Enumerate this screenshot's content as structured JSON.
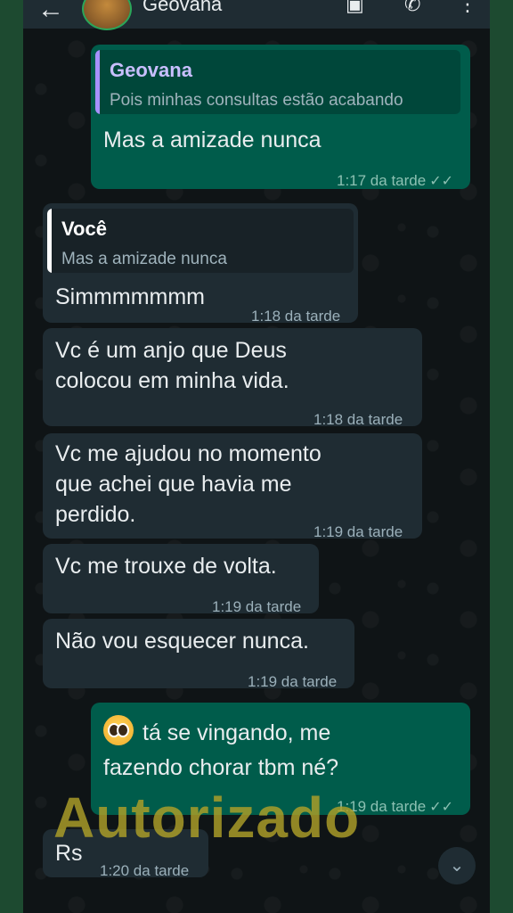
{
  "header": {
    "back_icon": "arrow-left-icon",
    "contact_name": "Geovana",
    "icons": [
      "video-icon",
      "call-icon",
      "more-vert-icon"
    ]
  },
  "messages": [
    {
      "dir": "out",
      "quote_name": "Geovana",
      "quote_text": "Pois minhas consultas estão acabando",
      "text": "Mas a amizade nunca",
      "time": "1:17 da tarde"
    },
    {
      "dir": "in",
      "quote_name": "Você",
      "quote_text": "Mas a amizade nunca",
      "text": "Simmmmmmm",
      "time": "1:18 da tarde"
    },
    {
      "dir": "in",
      "text_lines": [
        "Vc é  um anjo  que Deus",
        "colocou em minha  vida."
      ],
      "time": "1:18 da tarde"
    },
    {
      "dir": "in",
      "text_lines": [
        "Vc me ajudou no momento",
        "que achei que havia me",
        "perdido."
      ],
      "time": "1:19 da tarde"
    },
    {
      "dir": "in",
      "text": "Vc me trouxe de volta.",
      "time": "1:19 da tarde"
    },
    {
      "dir": "in",
      "text": "Não vou esquecer nunca.",
      "time": "1:19 da tarde"
    },
    {
      "dir": "out",
      "emoji": "pleading-face-emoji",
      "text_lines": [
        "tá se vingando, me",
        "fazendo chorar tbm né?"
      ],
      "time": "1:19 da tarde"
    },
    {
      "dir": "in",
      "text": "Rs",
      "time": "1:20 da tarde"
    }
  ],
  "watermark": "Autorizado",
  "scroll_down_icon": "double-chevron-down-icon",
  "colors": {
    "outgoing": "#005c4b",
    "incoming": "#1f2c33",
    "quote_bar_out": "#a791ff",
    "quote_bar_in": "#ffffff"
  }
}
